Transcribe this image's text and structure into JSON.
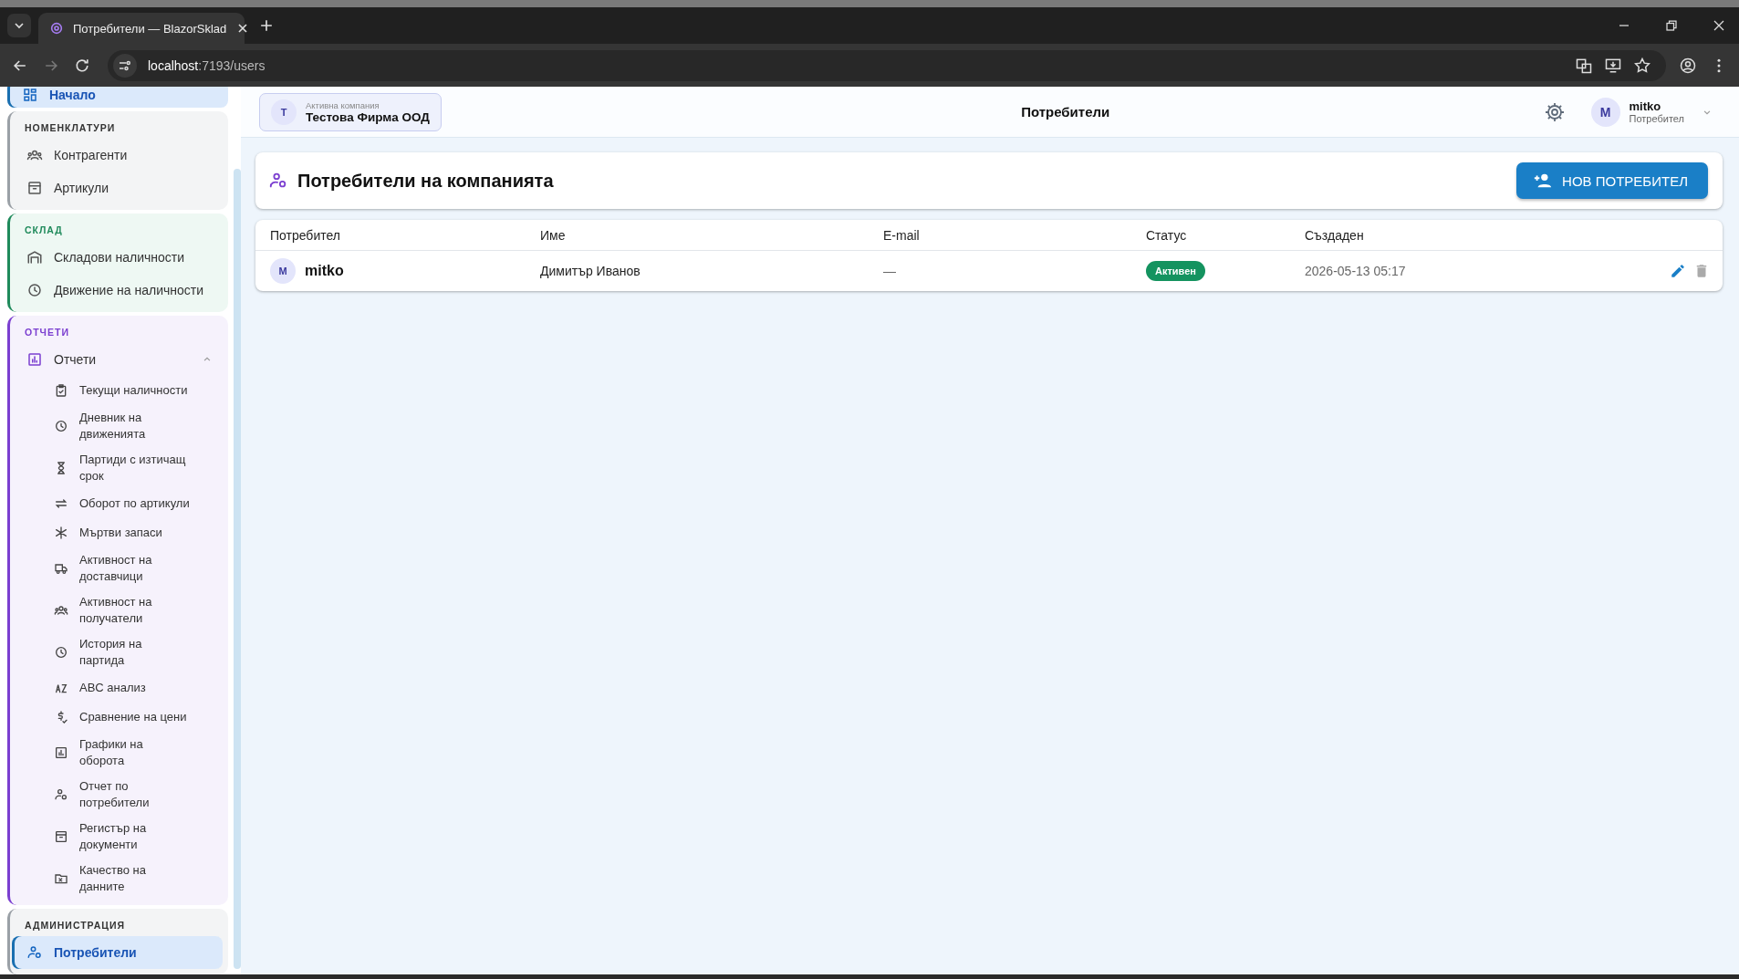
{
  "browser": {
    "tab_title": "Потребители — BlazorSklad",
    "url_host": "localhost",
    "url_path": ":7193/users"
  },
  "sidebar": {
    "top_item": {
      "label": "Начало",
      "selected": true
    },
    "sections": [
      {
        "title": "НОМЕНКЛАТУРИ",
        "color": "#9aa0a6",
        "items": [
          {
            "label": "Контрагенти",
            "selected": false
          },
          {
            "label": "Артикули",
            "selected": false
          }
        ]
      },
      {
        "title": "СКЛАД",
        "color": "#1f8a5b",
        "items": [
          {
            "label": "Складови наличности",
            "selected": false
          },
          {
            "label": "Движение на наличности",
            "selected": false
          }
        ]
      },
      {
        "title": "ОТЧЕТИ",
        "color": "#7b3fd0",
        "items": [
          {
            "label": "Отчети",
            "selected": false,
            "expanded": true,
            "children": [
              {
                "label": "Текущи наличности"
              },
              {
                "label": "Дневник на движенията"
              },
              {
                "label": "Партиди с изтичащ срок"
              },
              {
                "label": "Оборот по артикули"
              },
              {
                "label": "Мъртви запаси"
              },
              {
                "label": "Активност на доставчици"
              },
              {
                "label": "Активност на получатели"
              },
              {
                "label": "История на партида"
              },
              {
                "label": "ABC анализ"
              },
              {
                "label": "Сравнение на цени"
              },
              {
                "label": "Графики на оборота"
              },
              {
                "label": "Отчет по потребители"
              },
              {
                "label": "Регистър на документи"
              },
              {
                "label": "Качество на данните"
              }
            ]
          }
        ]
      },
      {
        "title": "АДМИНИСТРАЦИЯ",
        "color": "#9aa0a6",
        "items": [
          {
            "label": "Потребители",
            "selected": true
          }
        ]
      }
    ]
  },
  "header": {
    "company_label": "Активна компания",
    "company_name": "Тестова Фирма ООД",
    "company_initial": "Т",
    "title": "Потребители",
    "user_initial": "M",
    "user_name": "mitko",
    "user_role": "Потребител"
  },
  "page": {
    "title": "Потребители на компанията",
    "new_button": "НОВ ПОТРЕБИТЕЛ"
  },
  "table": {
    "columns": [
      "Потребител",
      "Име",
      "E-mail",
      "Статус",
      "Създаден"
    ],
    "rows": [
      {
        "initial": "M",
        "username": "mitko",
        "name": "Димитър Иванов",
        "email": "—",
        "status": "Активен",
        "active": true,
        "created": "2026-05-13 05:17"
      }
    ]
  }
}
